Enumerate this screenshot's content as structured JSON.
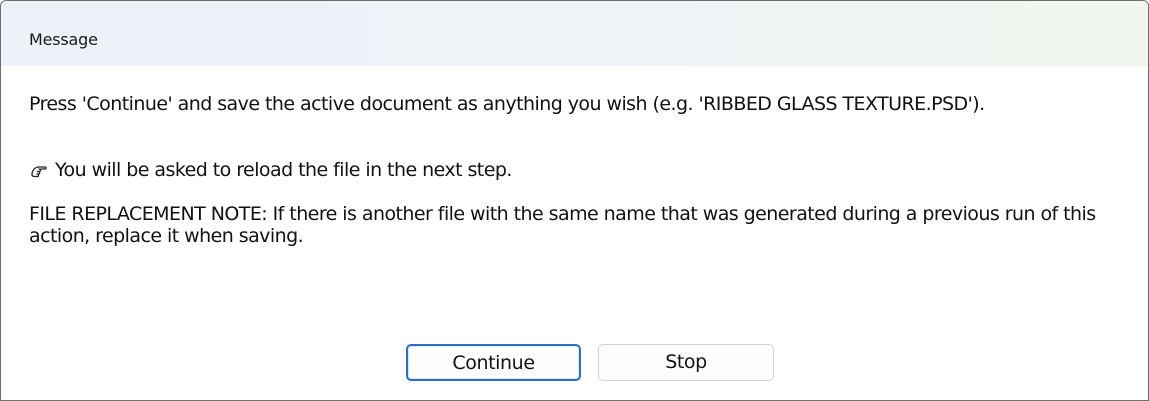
{
  "window": {
    "title": "Message"
  },
  "message": {
    "paragraph_1": "Press 'Continue' and save the active document as anything you wish (e.g. 'RIBBED GLASS TEXTURE.PSD').",
    "paragraph_2_icon": "pointing-hand-icon",
    "paragraph_2": "You will be asked to reload the file in the next step.",
    "paragraph_3": "FILE REPLACEMENT NOTE: If there is another file with the same name that was generated during a previous run of this action, replace it when saving."
  },
  "buttons": {
    "continue_label": "Continue",
    "stop_label": "Stop"
  },
  "colors": {
    "default_button_border": "#2f6fbf",
    "button_border": "#d0d0d0",
    "titlebar_background": "#eff3f7"
  }
}
